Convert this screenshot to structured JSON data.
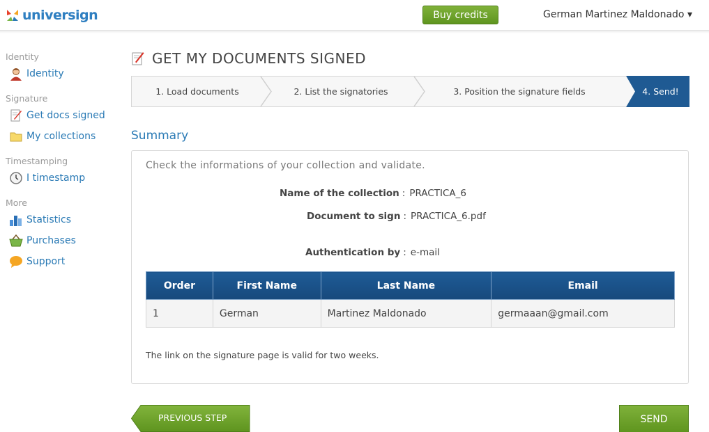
{
  "header": {
    "logo_text": "universign",
    "buy_credits": "Buy credits",
    "user_name": "German Martinez Maldonado ▾"
  },
  "sidebar": {
    "sections": [
      {
        "title": "Identity",
        "items": [
          {
            "label": "Identity",
            "icon": "user-icon"
          }
        ]
      },
      {
        "title": "Signature",
        "items": [
          {
            "label": "Get docs signed",
            "icon": "pen-doc-icon"
          },
          {
            "label": "My collections",
            "icon": "folder-icon"
          }
        ]
      },
      {
        "title": "Timestamping",
        "items": [
          {
            "label": "I timestamp",
            "icon": "clock-icon"
          }
        ]
      },
      {
        "title": "More",
        "items": [
          {
            "label": "Statistics",
            "icon": "bar-chart-icon"
          },
          {
            "label": "Purchases",
            "icon": "basket-icon"
          },
          {
            "label": "Support",
            "icon": "speech-bubble-icon"
          }
        ]
      }
    ]
  },
  "page_title": "GET MY DOCUMENTS SIGNED",
  "steps": [
    "1. Load documents",
    "2. List the signatories",
    "3. Position the signature fields",
    "4. Send!"
  ],
  "active_step": 4,
  "summary": {
    "title": "Summary",
    "instructions": "Check the informations of your collection and validate.",
    "collection_label": "Name of the collection",
    "collection_value": "PRACTICA_6",
    "document_label": "Document to sign",
    "document_value": "PRACTICA_6.pdf",
    "auth_label": "Authentication by",
    "auth_value": "e-mail",
    "colon": ":",
    "table": {
      "headers": [
        "Order",
        "First Name",
        "Last Name",
        "Email"
      ],
      "rows": [
        [
          "1",
          "German",
          "Martinez Maldonado",
          "germaaan@gmail.com"
        ]
      ]
    },
    "validity_note": "The link on the signature page is valid for two weeks."
  },
  "buttons": {
    "previous": "PREVIOUS STEP",
    "send": "SEND"
  },
  "colors": {
    "brand_blue": "#2a7ab5",
    "active_step": "#1f5a93",
    "green_button": "#6aa22a"
  }
}
